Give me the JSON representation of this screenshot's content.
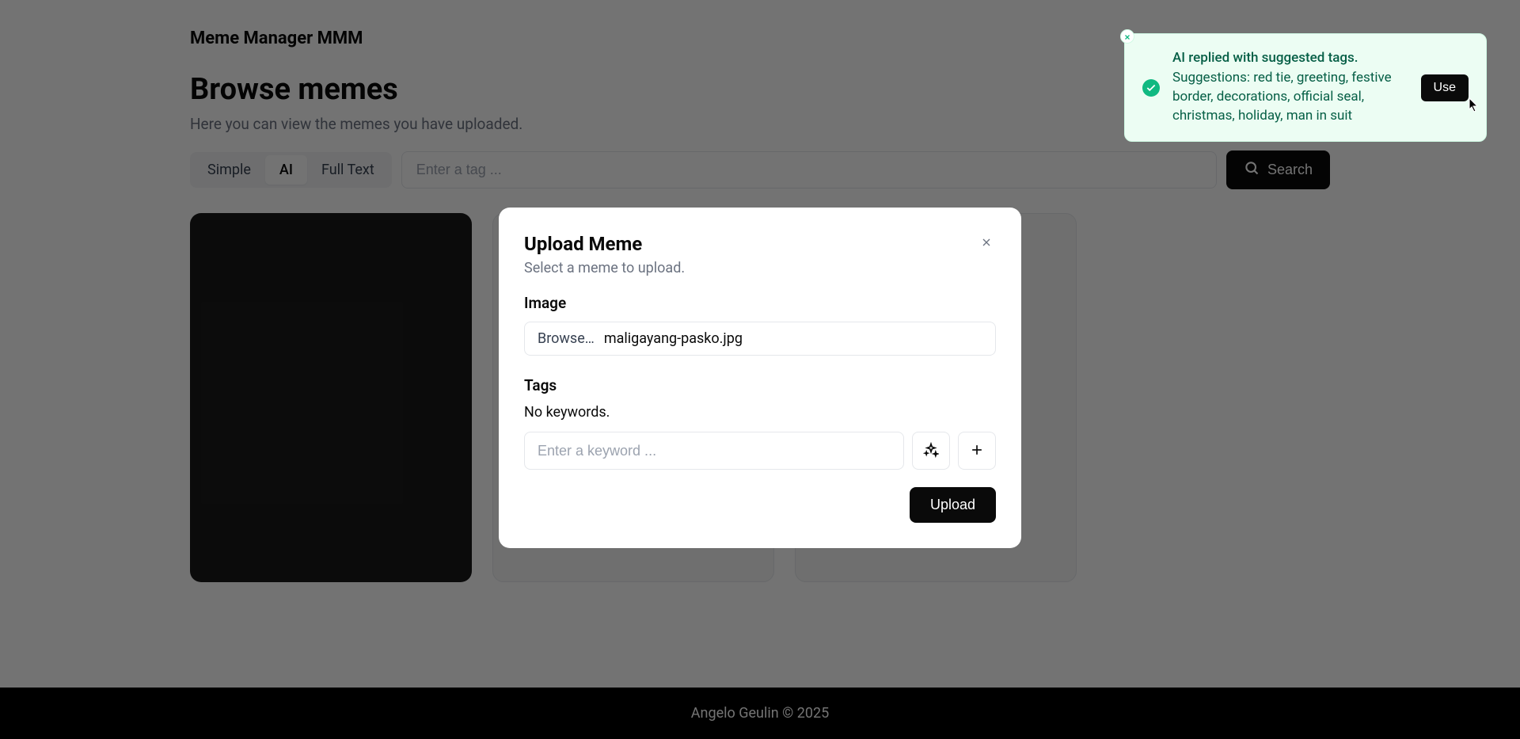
{
  "app": {
    "title": "Meme Manager MMM"
  },
  "page": {
    "heading": "Browse memes",
    "subtitle": "Here you can view the memes you have uploaded."
  },
  "search": {
    "tabs": {
      "simple": "Simple",
      "ai": "AI",
      "fulltext": "Full Text"
    },
    "placeholder": "Enter a tag ...",
    "button": "Search"
  },
  "modal": {
    "title": "Upload Meme",
    "subtitle": "Select a meme to upload.",
    "image_label": "Image",
    "browse_label": "Browse…",
    "filename": "maligayang-pasko.jpg",
    "tags_label": "Tags",
    "no_keywords": "No keywords.",
    "keyword_placeholder": "Enter a keyword ...",
    "upload_button": "Upload"
  },
  "toast": {
    "title": "AI replied with suggested tags.",
    "text": "Suggestions: red tie, greeting, festive border, decorations, official seal, christmas, holiday, man in suit",
    "action": "Use"
  },
  "footer": {
    "text": "Angelo Geulin © 2025"
  }
}
